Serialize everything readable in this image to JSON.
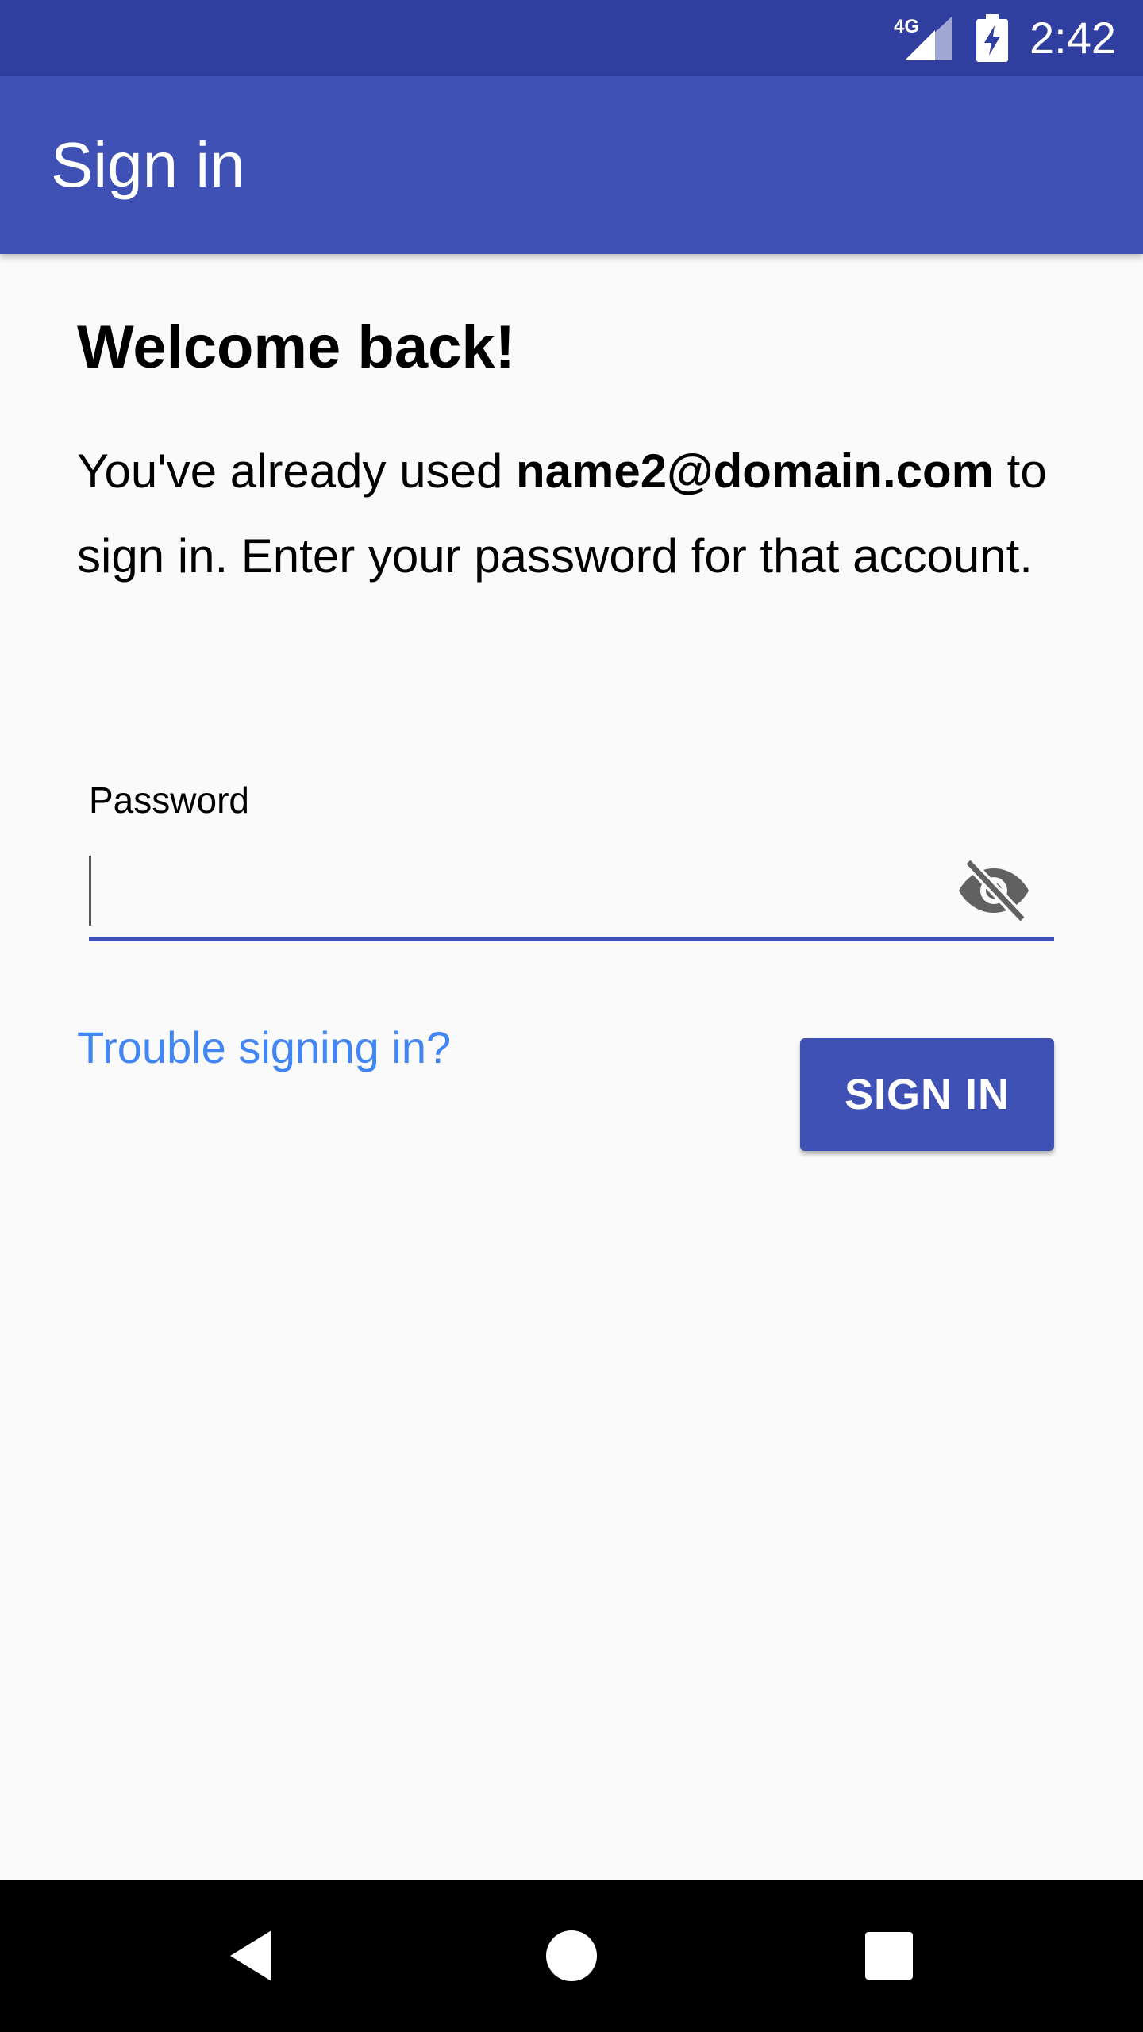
{
  "status_bar": {
    "time": "2:42",
    "network": "4G",
    "icons": [
      "signal-icon",
      "battery-charging-icon"
    ]
  },
  "app_bar": {
    "title": "Sign in",
    "color": "#3f51b5"
  },
  "content": {
    "heading": "Welcome back!",
    "message_prefix": "You've already used ",
    "email": "name2@domain.com",
    "message_suffix": " to sign in. Enter your password for that account."
  },
  "password_field": {
    "label": "Password",
    "value": "",
    "toggle_icon": "visibility-off-icon"
  },
  "actions": {
    "trouble_link": "Trouble signing in?",
    "sign_in_button": "SIGN IN",
    "link_color": "#4285f4",
    "button_color": "#3f51b5"
  },
  "nav_bar": {
    "icons": [
      "back-icon",
      "home-icon",
      "recents-icon"
    ]
  }
}
